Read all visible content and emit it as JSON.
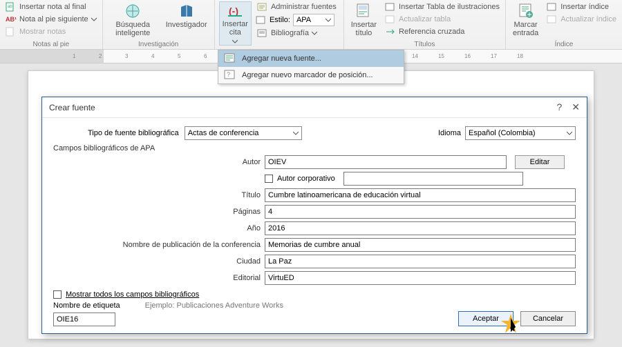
{
  "ribbon": {
    "group1": {
      "insert_endnote": "Insertar nota al final",
      "next_footnote": "Nota al pie siguiente",
      "show_notes": "Mostrar notas",
      "label": "Notas al pie"
    },
    "group2": {
      "smart_lookup": "Búsqueda inteligente",
      "researcher": "Investigador",
      "label": "Investigación"
    },
    "group3": {
      "insert_citation": "Insertar cita",
      "manage_sources": "Administrar fuentes",
      "style_label": "Estilo:",
      "style_value": "APA",
      "bibliography": "Bibliografía",
      "label": ""
    },
    "group4": {
      "insert_caption": "Insertar título",
      "insert_tof": "Insertar Tabla de ilustraciones",
      "update_table": "Actualizar tabla",
      "cross_ref": "Referencia cruzada",
      "label": "Títulos"
    },
    "group5": {
      "mark_entry": "Marcar entrada",
      "insert_index": "Insertar índice",
      "update_index": "Actualizar índice",
      "label": "Índice"
    }
  },
  "menu": {
    "add_new_source": "Agregar nueva fuente...",
    "add_placeholder": "Agregar nuevo marcador de posición..."
  },
  "dialog": {
    "title": "Crear fuente",
    "type_label": "Tipo de fuente bibliográfica",
    "type_value": "Actas de conferencia",
    "language_label": "Idioma",
    "language_value": "Español (Colombia)",
    "apa_fields": "Campos bibliográficos de APA",
    "author_label": "Autor",
    "author_value": "OIEV",
    "edit": "Editar",
    "corp_author": "Autor corporativo",
    "title_label": "Título",
    "title_value": "Cumbre latinoamericana de educación virtual",
    "pages_label": "Páginas",
    "pages_value": "4",
    "year_label": "Año",
    "year_value": "2016",
    "conf_name_label": "Nombre de publicación de la conferencia",
    "conf_name_value": "Memorias de cumbre anual",
    "city_label": "Ciudad",
    "city_value": "La Paz",
    "publisher_label": "Editorial",
    "publisher_value": "VirtuED",
    "show_all": "Mostrar todos los campos bibliográficos",
    "tag_name_label": "Nombre de etiqueta",
    "example": "Ejemplo: Publicaciones Adventure Works",
    "tag_value": "OIE16",
    "accept": "Aceptar",
    "cancel": "Cancelar"
  }
}
